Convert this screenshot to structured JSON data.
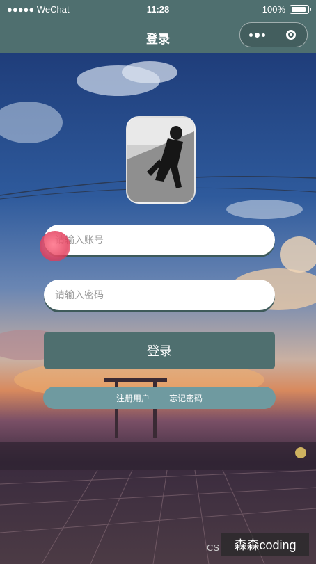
{
  "status_bar": {
    "carrier": "●●●●● WeChat",
    "time": "11:28",
    "battery": "100%"
  },
  "nav": {
    "title": "登录",
    "more_icon": "more-dots-icon",
    "close_icon": "target-circle-icon"
  },
  "form": {
    "account_placeholder": "请输入账号",
    "password_placeholder": "请输入密码",
    "login_button": "登录",
    "register_link": "注册用户",
    "forgot_link": "忘记密码"
  },
  "watermark": {
    "prefix": "CS",
    "text": "森森coding"
  },
  "colors": {
    "theme": "#4f6f6f",
    "links_bar": "#6f9aa0"
  }
}
